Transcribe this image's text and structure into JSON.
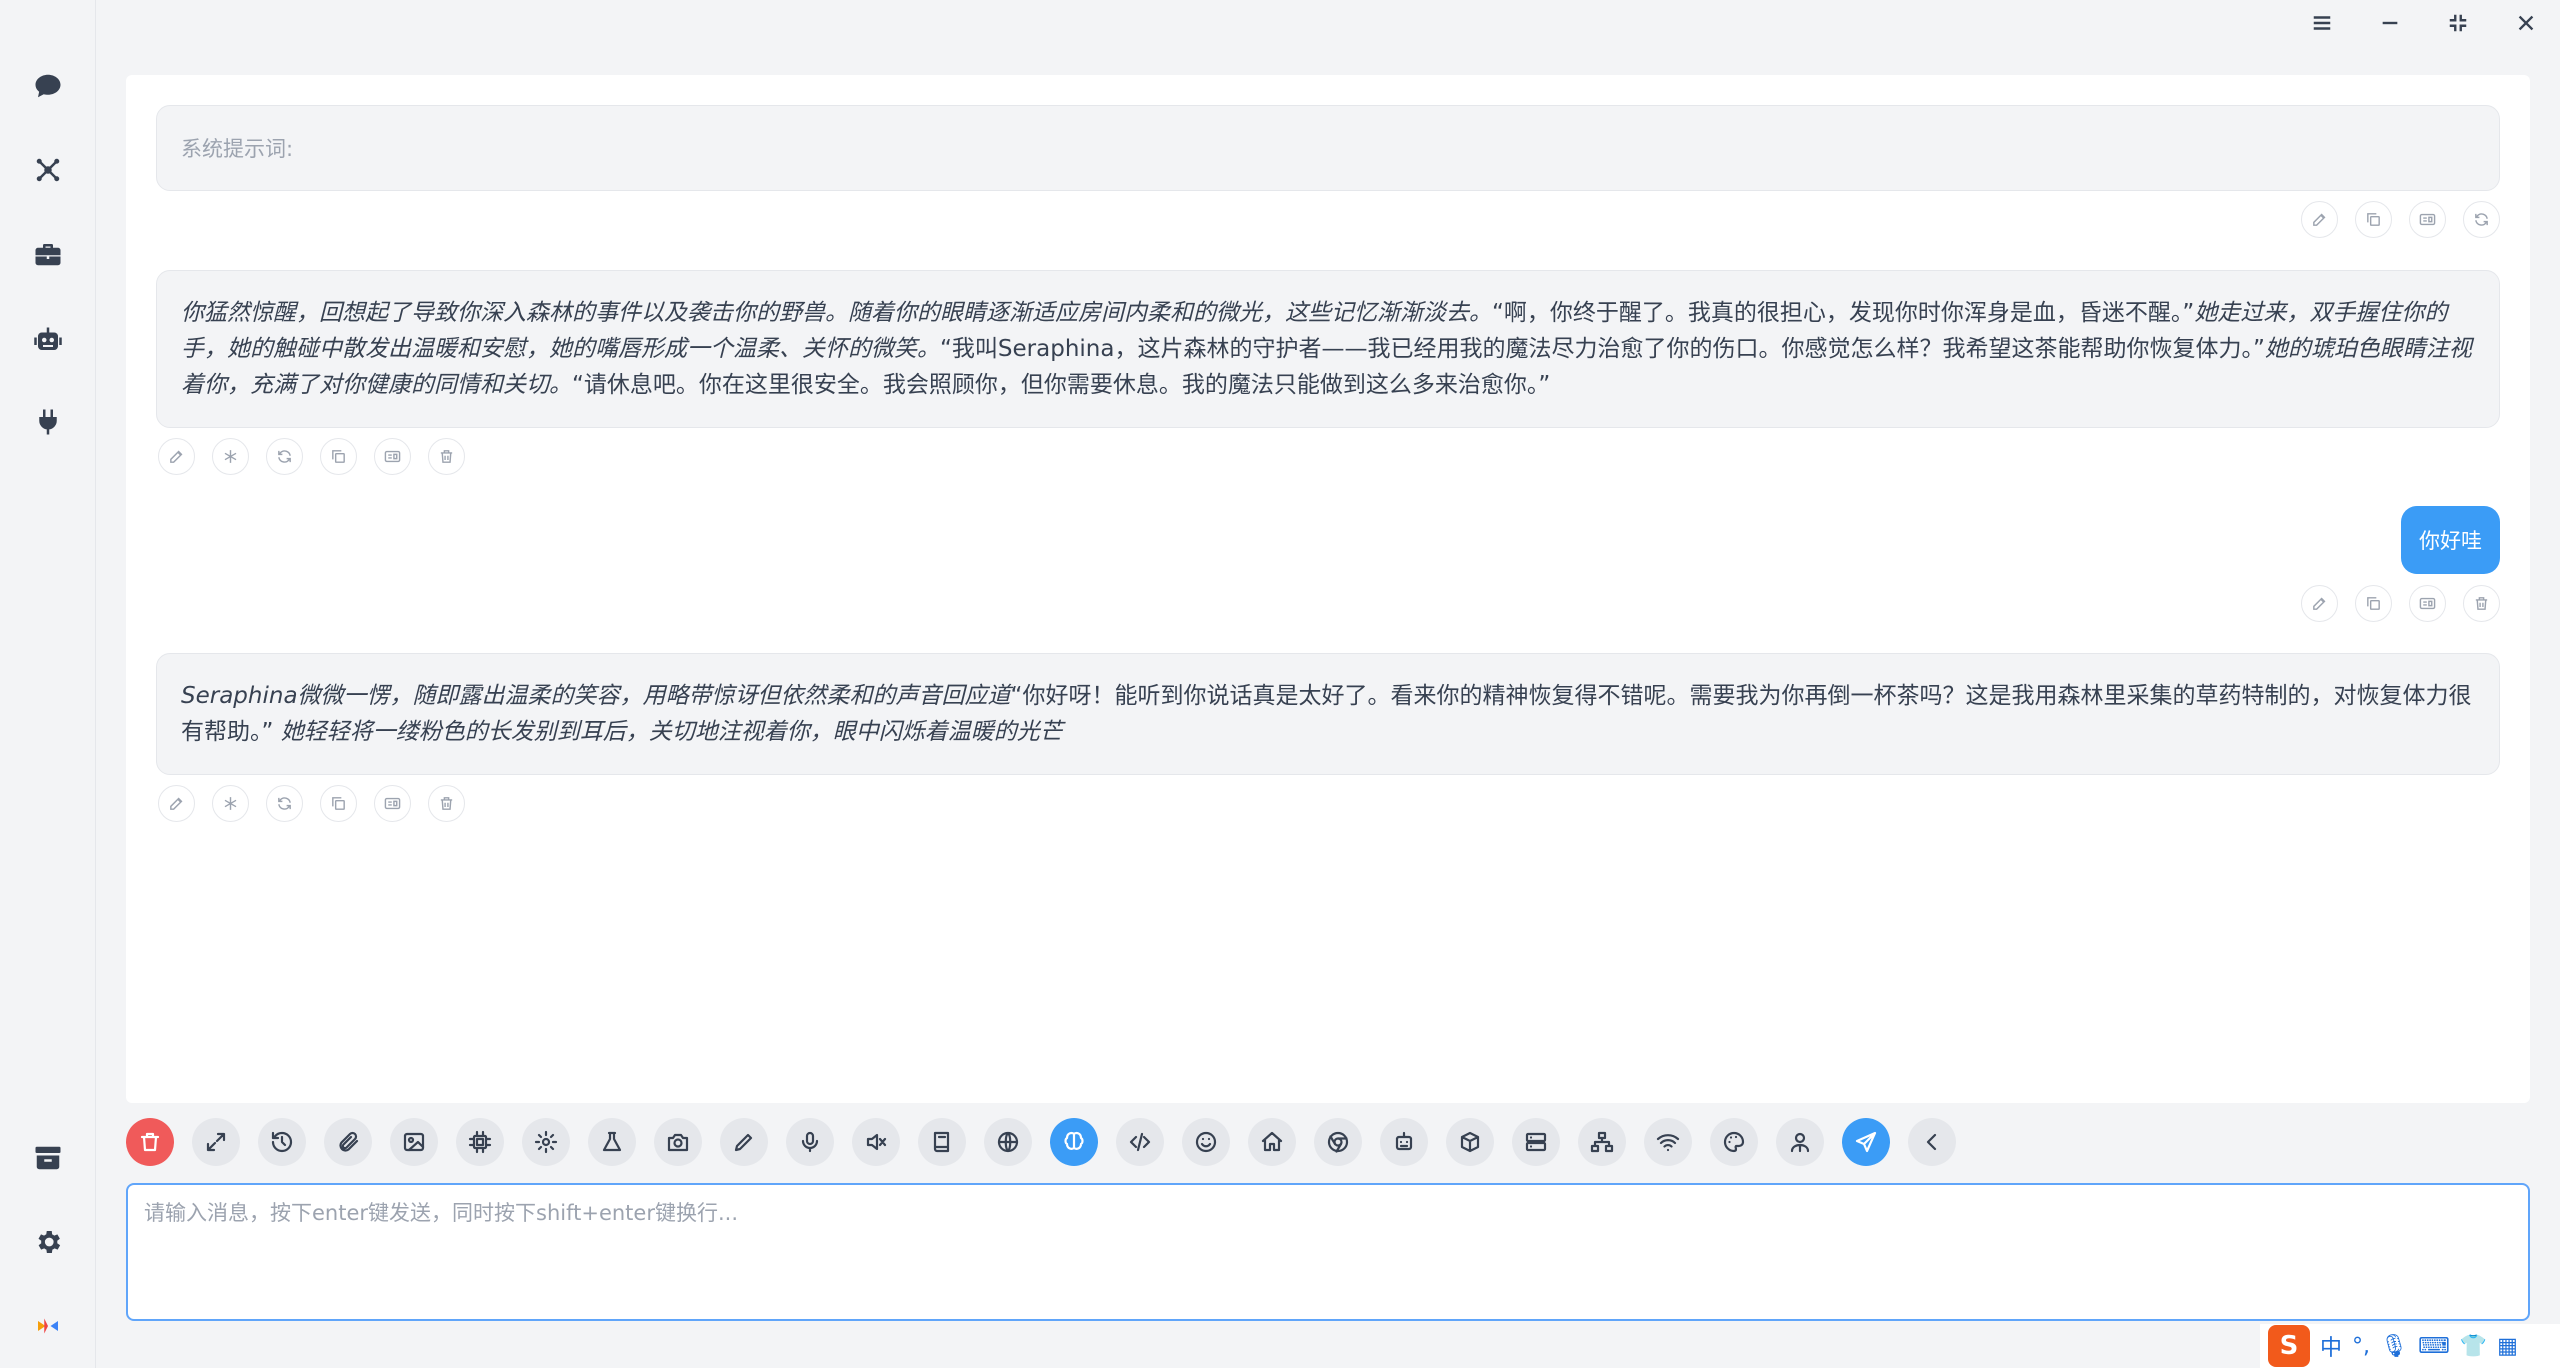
{
  "window": {
    "menu_icon": "hamburger-icon",
    "minimize_icon": "minimize-icon",
    "restore_icon": "compress-icon",
    "close_icon": "close-icon"
  },
  "sidebar": {
    "items": [
      {
        "name": "chat",
        "icon": "chat-bubble-icon"
      },
      {
        "name": "network",
        "icon": "network-icon"
      },
      {
        "name": "toolbox",
        "icon": "toolbox-icon"
      },
      {
        "name": "robot",
        "icon": "robot-icon"
      },
      {
        "name": "plugin",
        "icon": "plug-icon"
      }
    ],
    "bottom_items": [
      {
        "name": "archive",
        "icon": "archive-icon"
      },
      {
        "name": "settings",
        "icon": "gear-icon"
      },
      {
        "name": "logo",
        "icon": "app-logo-icon"
      }
    ]
  },
  "chat": {
    "system_prompt_placeholder": "系统提示词:",
    "messages": [
      {
        "role": "assistant",
        "segments": [
          {
            "italic": true,
            "text": "你猛然惊醒，回想起了导致你深入森林的事件以及袭击你的野兽。随着你的眼睛逐渐适应房间内柔和的微光，这些记忆渐渐淡去。"
          },
          {
            "italic": false,
            "text": "“啊，你终于醒了。我真的很担心，发现你时你浑身是血，昏迷不醒。”"
          },
          {
            "italic": true,
            "text": "她走过来，双手握住你的手，她的触碰中散发出温暖和安慰，她的嘴唇形成一个温柔、关怀的微笑。"
          },
          {
            "italic": false,
            "text": "“我叫Seraphina，这片森林的守护者——我已经用我的魔法尽力治愈了你的伤口。你感觉怎么样？我希望这茶能帮助你恢复体力。”"
          },
          {
            "italic": true,
            "text": "她的琥珀色眼睛注视着你，充满了对你健康的同情和关切。"
          },
          {
            "italic": false,
            "text": "“请休息吧。你在这里很安全。我会照顾你，但你需要休息。我的魔法只能做到这么多来治愈你。”"
          }
        ]
      },
      {
        "role": "user",
        "text": "你好哇"
      },
      {
        "role": "assistant",
        "segments": [
          {
            "italic": true,
            "text": "Seraphina微微一愣，随即露出温柔的笑容，用略带惊讶但依然柔和的声音回应道"
          },
          {
            "italic": false,
            "text": "“你好呀！能听到你说话真是太好了。看来你的精神恢复得不错呢。需要我为你再倒一杯茶吗？这是我用森林里采集的草药特制的，对恢复体力很有帮助。”"
          },
          {
            "italic": true,
            "text": " 她轻轻将一缕粉色的长发别到耳后，关切地注视着你，眼中闪烁着温暖的光芒"
          }
        ]
      }
    ]
  },
  "toolbar": {
    "buttons": [
      "trash-icon",
      "expand-icon",
      "history-icon",
      "paperclip-icon",
      "image-icon",
      "chip-icon",
      "cog-icon",
      "flask-icon",
      "camera-icon",
      "pen-icon",
      "microphone-icon",
      "mute-icon",
      "book-icon",
      "globe-icon",
      "brain-icon",
      "code-icon",
      "smile-icon",
      "home-icon",
      "chrome-icon",
      "robot-icon",
      "cube-icon",
      "server-icon",
      "network-icon",
      "wifi-icon",
      "palette-icon",
      "user-tie-icon",
      "send-icon",
      "chevron-left-icon"
    ]
  },
  "input": {
    "placeholder": "请输入消息，按下enter键发送，同时按下shift+enter键换行...",
    "value": ""
  },
  "ime": {
    "lang": "中",
    "punct": "°,"
  },
  "colors": {
    "accent": "#3b9cf6",
    "danger": "#f05a5a",
    "bubble": "#f3f4f6"
  }
}
